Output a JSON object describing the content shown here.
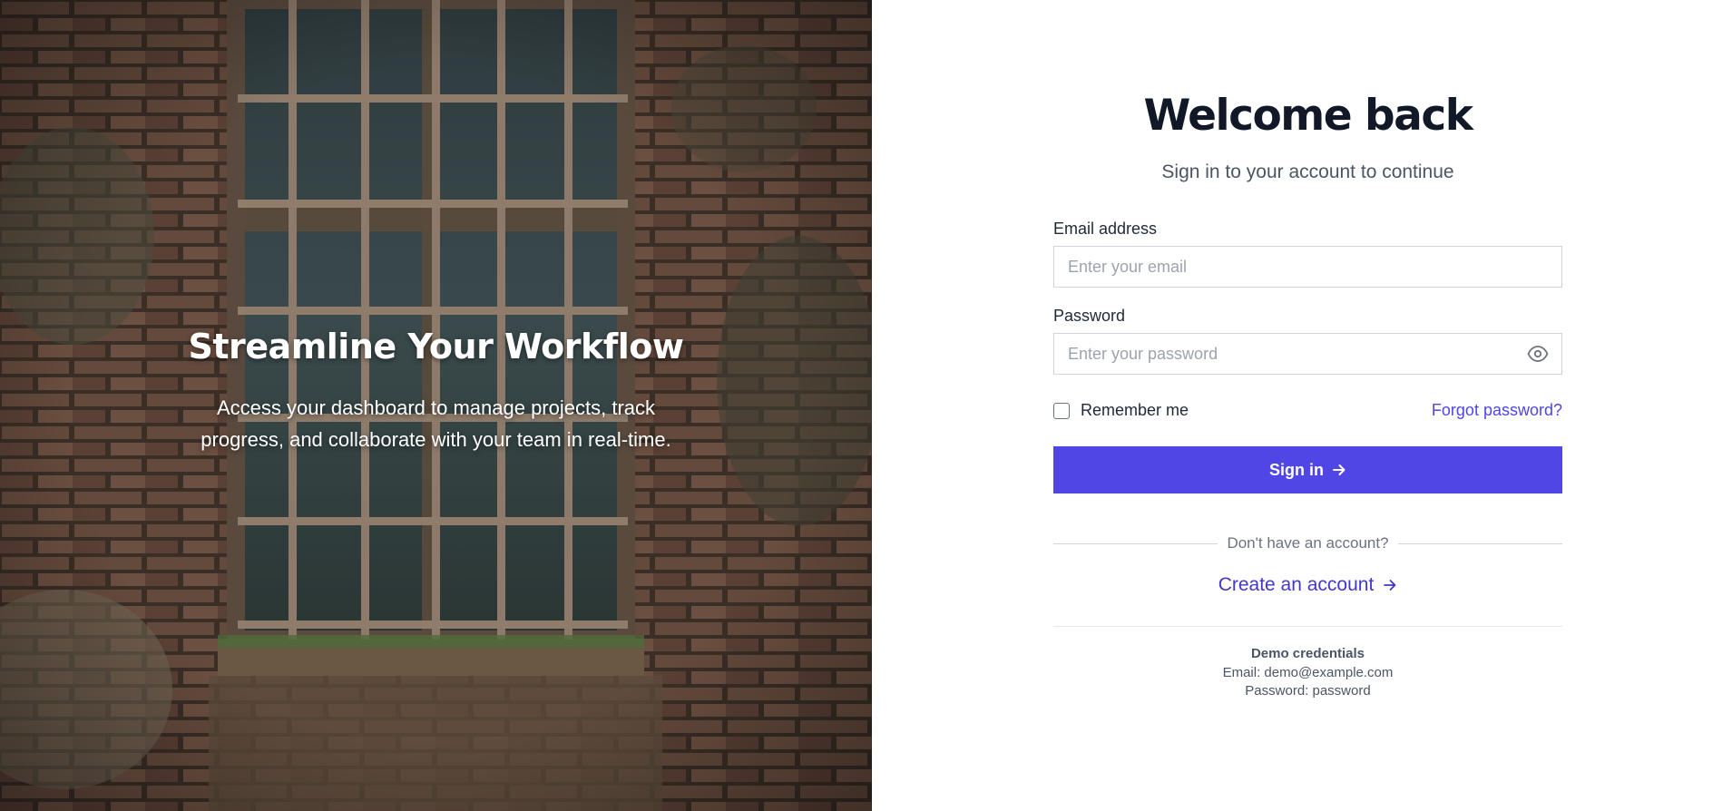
{
  "hero": {
    "title": "Streamline Your Workflow",
    "subtitle": "Access your dashboard to manage projects, track progress, and collaborate with your team in real-time."
  },
  "login": {
    "title": "Welcome back",
    "subtitle": "Sign in to your account to continue",
    "email_label": "Email address",
    "email_placeholder": "Enter your email",
    "email_value": "",
    "password_label": "Password",
    "password_placeholder": "Enter your password",
    "password_value": "",
    "remember_label": "Remember me",
    "remember_checked": false,
    "forgot_label": "Forgot password?",
    "signin_label": "Sign in",
    "divider_text": "Don't have an account?",
    "create_label": "Create an account"
  },
  "demo": {
    "title": "Demo credentials",
    "email_line": "Email: demo@example.com",
    "password_line": "Password: password"
  },
  "colors": {
    "accent": "#4f46e5",
    "link": "#4338ca"
  },
  "icons": {
    "password_toggle": "eye-icon",
    "signin_arrow": "arrow-right-icon",
    "create_arrow": "arrow-right-icon"
  }
}
